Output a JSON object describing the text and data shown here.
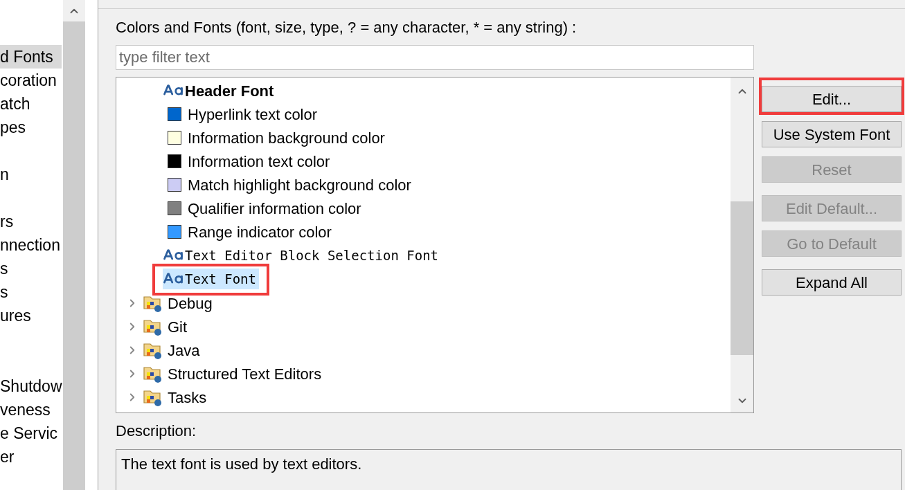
{
  "sidebar": {
    "items": [
      {
        "kind": "text",
        "label": "d Fonts",
        "selected": true
      },
      {
        "kind": "text",
        "label": "coration",
        "selected": false
      },
      {
        "kind": "text",
        "label": "atch",
        "selected": false
      },
      {
        "kind": "text",
        "label": "pes",
        "selected": false
      },
      {
        "kind": "blank"
      },
      {
        "kind": "text",
        "label": "n",
        "selected": false
      },
      {
        "kind": "blank"
      },
      {
        "kind": "text",
        "label": "rs",
        "selected": false
      },
      {
        "kind": "text",
        "label": "nnection",
        "selected": false
      },
      {
        "kind": "text",
        "label": "s",
        "selected": false
      },
      {
        "kind": "text",
        "label": "s",
        "selected": false
      },
      {
        "kind": "text",
        "label": "ures",
        "selected": false
      },
      {
        "kind": "blank"
      },
      {
        "kind": "blank"
      },
      {
        "kind": "text",
        "label": "Shutdow",
        "selected": false
      },
      {
        "kind": "text",
        "label": "veness",
        "selected": false
      },
      {
        "kind": "text",
        "label": "e Servic",
        "selected": false
      },
      {
        "kind": "text",
        "label": "er",
        "selected": false
      }
    ]
  },
  "title": "Colors and Fonts (font, size, type, ? = any character, * = any string) :",
  "filter": {
    "placeholder": "type filter text"
  },
  "tree": {
    "items": [
      {
        "kind": "bold_font",
        "label": "Header Font",
        "selected": false,
        "highlighted": false
      },
      {
        "kind": "color",
        "label": "Hyperlink text color",
        "color": "#0066cc",
        "selected": false,
        "highlighted": false
      },
      {
        "kind": "color",
        "label": "Information background color",
        "color": "#ffffe1",
        "selected": false,
        "highlighted": false
      },
      {
        "kind": "color",
        "label": "Information text color",
        "color": "#000000",
        "selected": false,
        "highlighted": false
      },
      {
        "kind": "color",
        "label": "Match highlight background color",
        "color": "#ccccf4",
        "selected": false,
        "highlighted": false
      },
      {
        "kind": "color",
        "label": "Qualifier information color",
        "color": "#808080",
        "selected": false,
        "highlighted": false
      },
      {
        "kind": "color",
        "label": "Range indicator color",
        "color": "#3399ff",
        "selected": false,
        "highlighted": false
      },
      {
        "kind": "mono_font",
        "label": "Text Editor Block Selection Font",
        "selected": false,
        "highlighted": false
      },
      {
        "kind": "mono_font",
        "label": "Text Font",
        "selected": true,
        "highlighted": true
      },
      {
        "kind": "folder",
        "label": "Debug",
        "expanded": false
      },
      {
        "kind": "folder",
        "label": "Git",
        "expanded": false
      },
      {
        "kind": "folder",
        "label": "Java",
        "expanded": false
      },
      {
        "kind": "folder",
        "label": "Structured Text Editors",
        "expanded": false
      },
      {
        "kind": "folder",
        "label": "Tasks",
        "expanded": false
      }
    ]
  },
  "button_groups": [
    {
      "buttons": [
        {
          "label": "Edit...",
          "disabled": false,
          "highlighted": true
        },
        {
          "label": "Use System Font",
          "disabled": false,
          "highlighted": false
        },
        {
          "label": "Reset",
          "disabled": true,
          "highlighted": false
        }
      ]
    },
    {
      "buttons": [
        {
          "label": "Edit Default...",
          "disabled": true,
          "highlighted": false
        },
        {
          "label": "Go to Default",
          "disabled": true,
          "highlighted": false
        }
      ]
    },
    {
      "buttons": [
        {
          "label": "Expand All",
          "disabled": false,
          "highlighted": false
        }
      ]
    }
  ],
  "description": {
    "label": "Description:",
    "text": "The text font is used by text editors."
  }
}
